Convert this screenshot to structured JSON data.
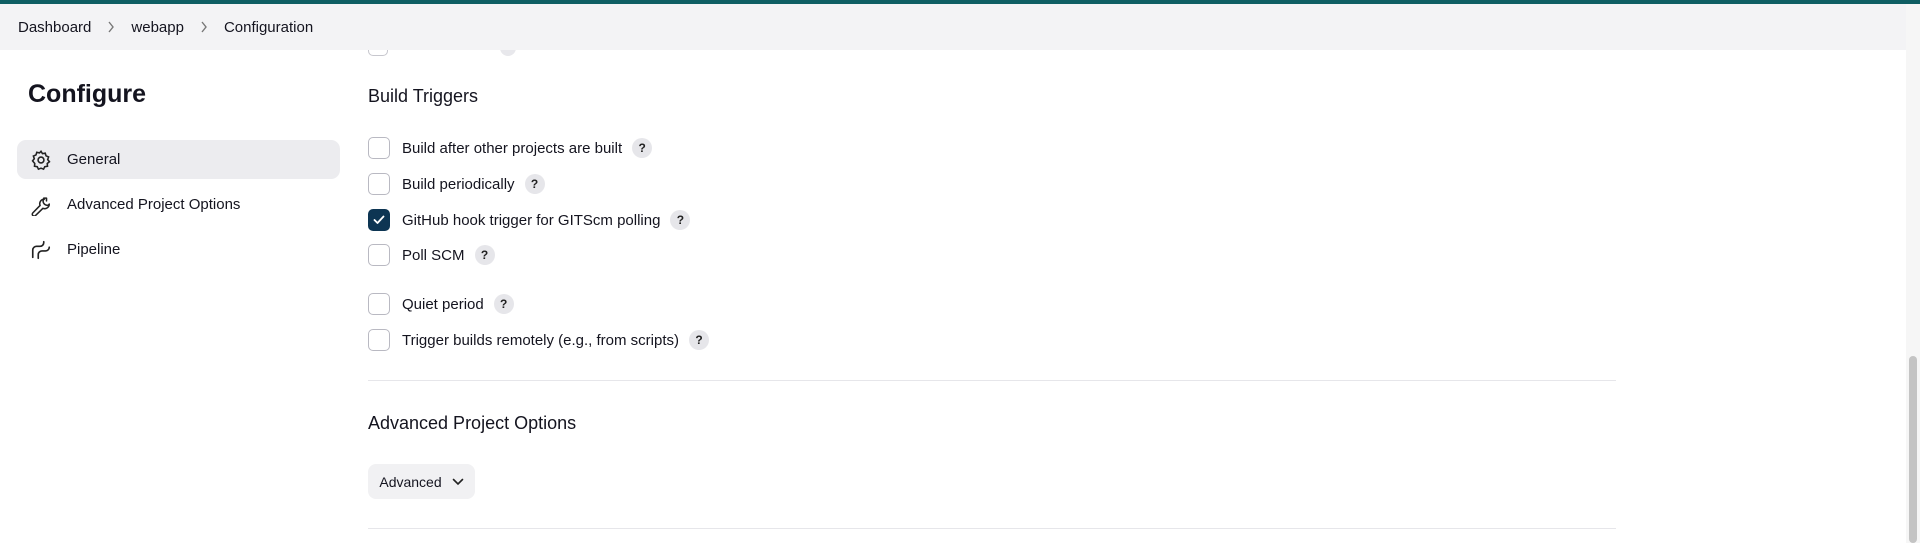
{
  "breadcrumb": [
    "Dashboard",
    "webapp",
    "Configuration"
  ],
  "sidebar": {
    "title": "Configure",
    "items": [
      {
        "label": "General",
        "icon": "gear-icon",
        "active": true
      },
      {
        "label": "Advanced Project Options",
        "icon": "wrench-icon",
        "active": false
      },
      {
        "label": "Pipeline",
        "icon": "pipeline-icon",
        "active": false
      }
    ]
  },
  "build_triggers": {
    "title": "Build Triggers",
    "options": [
      {
        "label": "Build after other projects are built",
        "checked": false
      },
      {
        "label": "Build periodically",
        "checked": false
      },
      {
        "label": "GitHub hook trigger for GITScm polling",
        "checked": true
      },
      {
        "label": "Poll SCM",
        "checked": false
      },
      {
        "label": "Quiet period",
        "checked": false
      },
      {
        "label": "Trigger builds remotely (e.g., from scripts)",
        "checked": false
      }
    ],
    "help_label": "?"
  },
  "advanced_options": {
    "title": "Advanced Project Options",
    "button_label": "Advanced"
  },
  "colors": {
    "accent": "#0f5e63",
    "checkbox_checked": "#0d3553"
  }
}
